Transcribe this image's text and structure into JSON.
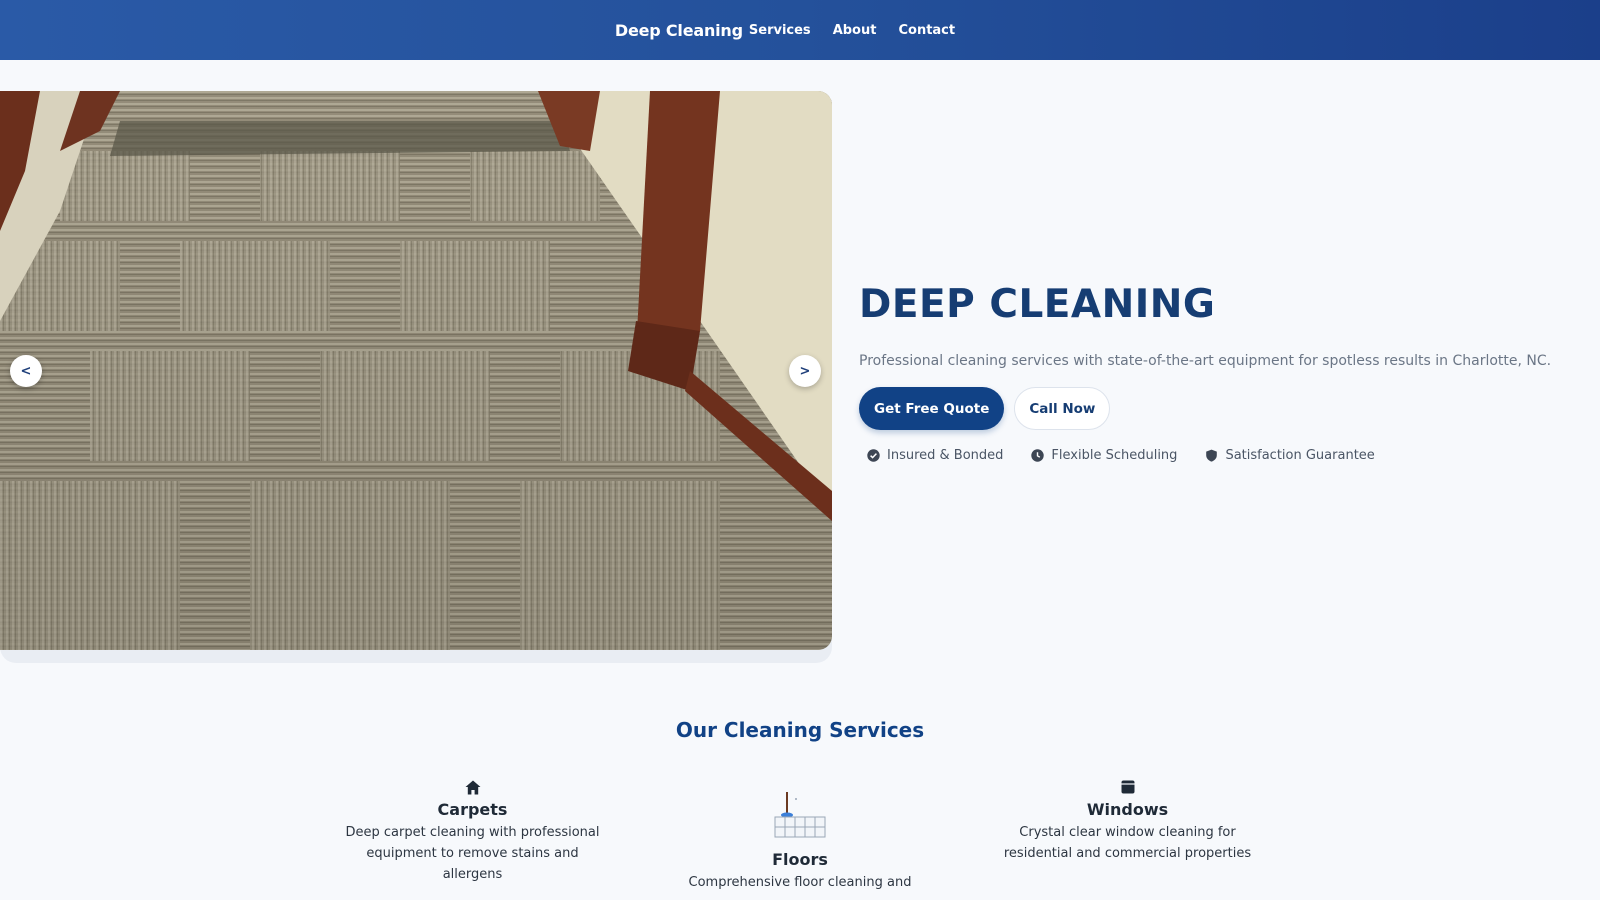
{
  "nav": {
    "brand": "Deep Cleaning",
    "links": [
      "Services",
      "About",
      "Contact"
    ]
  },
  "hero": {
    "carousel": {
      "prev_label": "<",
      "next_label": ">"
    },
    "title": "DEEP CLEANING",
    "subtitle": "Professional cleaning services with state-of-the-art equipment for spotless results in Charlotte, NC.",
    "primary_cta": "Get Free Quote",
    "secondary_cta": "Call Now",
    "features": [
      {
        "icon": "check-circle-icon",
        "label": "Insured & Bonded"
      },
      {
        "icon": "clock-icon",
        "label": "Flexible Scheduling"
      },
      {
        "icon": "shield-icon",
        "label": "Satisfaction Guarantee"
      }
    ]
  },
  "services": {
    "title": "Our Cleaning Services",
    "items": [
      {
        "icon": "home-icon",
        "name": "Carpets",
        "description": "Deep carpet cleaning with professional equipment to remove stains and allergens"
      },
      {
        "icon": "floor-mop-icon",
        "name": "Floors",
        "description": "Comprehensive floor cleaning and"
      },
      {
        "icon": "window-icon",
        "name": "Windows",
        "description": "Crystal clear window cleaning for residential and commercial properties"
      }
    ]
  },
  "colors": {
    "nav_start": "#2a5aa7",
    "nav_end": "#1b3f8a",
    "primary": "#114286",
    "title": "#163d73",
    "background": "#f7f9fc"
  }
}
